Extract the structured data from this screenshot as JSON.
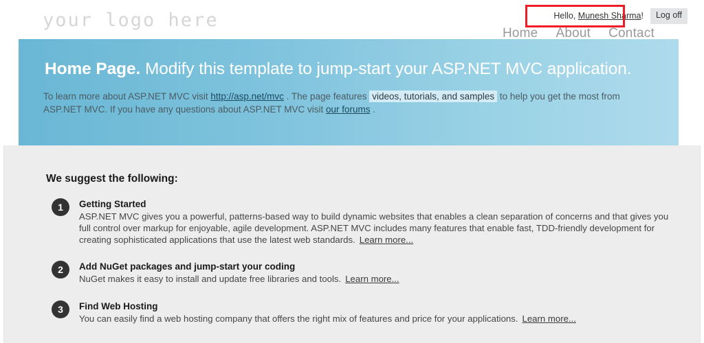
{
  "header": {
    "logo_text": "your logo here",
    "greeting_prefix": "Hello, ",
    "user_name": "Munesh Sharma",
    "greeting_suffix": "!",
    "logoff_label": "Log off",
    "nav": [
      {
        "label": "Home"
      },
      {
        "label": "About"
      },
      {
        "label": "Contact"
      }
    ]
  },
  "banner": {
    "title_bold": "Home Page.",
    "title_rest": " Modify this template to jump-start your ASP.NET MVC application.",
    "body": {
      "t1": "To learn more about ASP.NET MVC visit ",
      "link1": "http://asp.net/mvc",
      "t2": " . The page features ",
      "link2": "videos, tutorials, and samples",
      "t3": " to help you get the most from ASP.NET MVC. If you have any questions about ASP.NET MVC visit ",
      "link3": "our forums",
      "t4": " ."
    }
  },
  "content": {
    "heading": "We suggest the following:",
    "items": [
      {
        "number": "1",
        "title": "Getting Started",
        "description": "ASP.NET MVC gives you a powerful, patterns-based way to build dynamic websites that enables a clean separation of concerns and that gives you full control over markup for enjoyable, agile development. ASP.NET MVC includes many features that enable fast, TDD-friendly development for creating sophisticated applications that use the latest web standards.",
        "link_label": "Learn more..."
      },
      {
        "number": "2",
        "title": "Add NuGet packages and jump-start your coding",
        "description": "NuGet makes it easy to install and update free libraries and tools.",
        "link_label": "Learn more..."
      },
      {
        "number": "3",
        "title": "Find Web Hosting",
        "description": "You can easily find a web hosting company that offers the right mix of features and price for your applications.",
        "link_label": "Learn more..."
      }
    ]
  },
  "annotation": {
    "highlight_color": "#ee1c25"
  },
  "colors": {
    "banner_start": "#69b7d5",
    "banner_end": "#aedbec",
    "content_bg": "#ededed",
    "badge_bg": "#333333",
    "nav_text": "#999999",
    "logo_text": "#d6d6d6"
  }
}
